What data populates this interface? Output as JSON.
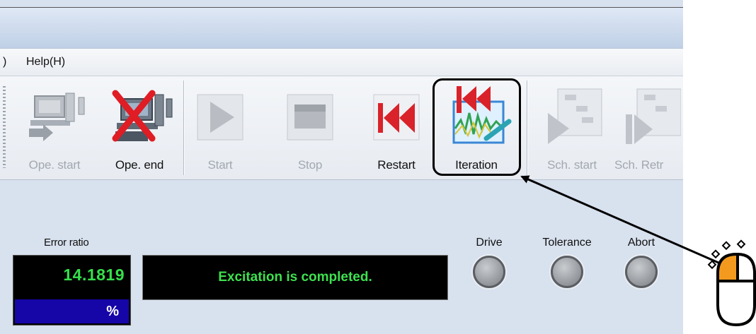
{
  "menu": {
    "partial_item": ")",
    "help": "Help(H)"
  },
  "toolbar": {
    "ope_start": "Ope. start",
    "ope_end": "Ope. end",
    "start": "Start",
    "stop": "Stop",
    "restart": "Restart",
    "iteration": "Iteration",
    "sch_start": "Sch. start",
    "sch_retry": "Sch. Retr"
  },
  "status": {
    "error_label": "Error ratio",
    "error_value": "14.1819",
    "error_unit": "%",
    "message": "Excitation is completed.",
    "indicators": [
      "Drive",
      "Tolerance",
      "Abort"
    ]
  },
  "colors": {
    "readout_green": "#35e04b",
    "unit_band": "#1606a8",
    "stop_red": "#e01c24",
    "click_orange": "#f39a1e"
  },
  "icons": {
    "ope_start": "computer-connect-icon",
    "ope_end": "computer-disconnect-icon",
    "start": "play-icon",
    "stop": "stop-icon",
    "restart": "rewind-icon",
    "iteration": "iteration-waveform-icon",
    "sch_start": "schedule-start-icon",
    "sch_retry": "schedule-retry-icon",
    "pointer": "mouse-left-click-icon"
  }
}
